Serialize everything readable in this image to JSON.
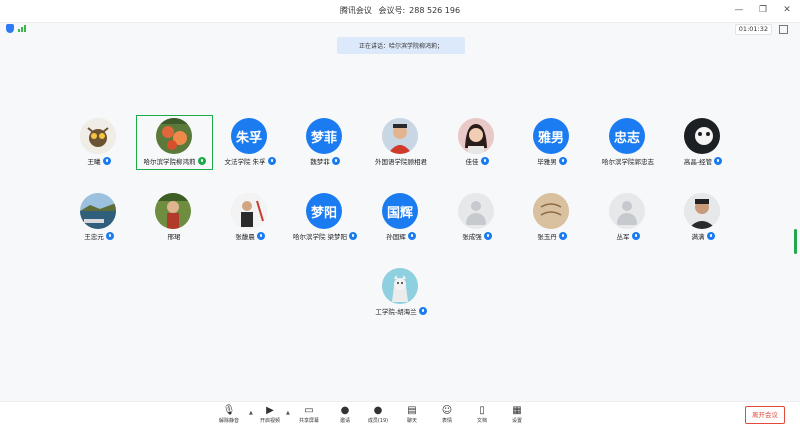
{
  "window": {
    "app_name": "腾讯会议",
    "meeting_id_label": "会议号:",
    "meeting_id": "288 526 196"
  },
  "status": {
    "timer": "01:01:32"
  },
  "speaker": {
    "text": "正在讲话：哈尔滨学院柳鸿莉；"
  },
  "participants": [
    {
      "name": "王曦",
      "avatar_type": "photo",
      "mic": "blue"
    },
    {
      "name": "哈尔滨学院柳鸿莉",
      "avatar_type": "photo",
      "mic": "green"
    },
    {
      "name": "文法学院 朱孚",
      "avatar_type": "text",
      "avatar_text": "朱孚",
      "mic": "blue"
    },
    {
      "name": "魏梦菲",
      "avatar_type": "text",
      "avatar_text": "梦菲",
      "mic": "blue"
    },
    {
      "name": "外国语学院顾相君",
      "avatar_type": "photo",
      "mic": "none"
    },
    {
      "name": "佳佳",
      "avatar_type": "photo",
      "mic": "blue"
    },
    {
      "name": "毕雅男",
      "avatar_type": "text",
      "avatar_text": "雅男",
      "mic": "blue"
    },
    {
      "name": "哈尔滨学院郭忠志",
      "avatar_type": "text",
      "avatar_text": "忠志",
      "mic": "none"
    },
    {
      "name": "高晶-经管",
      "avatar_type": "photo",
      "mic": "blue"
    },
    {
      "name": "王忠元",
      "avatar_type": "photo",
      "mic": "blue"
    },
    {
      "name": "邢珺",
      "avatar_type": "photo",
      "mic": "none"
    },
    {
      "name": "张馥晨",
      "avatar_type": "photo",
      "mic": "blue"
    },
    {
      "name": "哈尔滨学院 梁梦阳",
      "avatar_type": "text",
      "avatar_text": "梦阳",
      "mic": "blue"
    },
    {
      "name": "孙国辉",
      "avatar_type": "text",
      "avatar_text": "国辉",
      "mic": "blue"
    },
    {
      "name": "张成强",
      "avatar_type": "placeholder",
      "mic": "blue"
    },
    {
      "name": "张玉丹",
      "avatar_type": "photo",
      "mic": "blue"
    },
    {
      "name": "丛军",
      "avatar_type": "placeholder",
      "mic": "blue"
    },
    {
      "name": "满满",
      "avatar_type": "photo",
      "mic": "blue"
    },
    {
      "name": "工学院-胡海兰",
      "avatar_type": "photo",
      "mic": "blue"
    }
  ],
  "toolbar": {
    "items": [
      {
        "label": "解除静音",
        "icon": "mic-muted-icon"
      },
      {
        "label": "开启视频",
        "icon": "video-off-icon"
      },
      {
        "label": "共享屏幕",
        "icon": "screen-share-icon"
      },
      {
        "label": "邀请",
        "icon": "invite-icon"
      },
      {
        "label": "成员(19)",
        "icon": "members-icon"
      },
      {
        "label": "聊天",
        "icon": "chat-icon"
      },
      {
        "label": "表情",
        "icon": "emoji-icon"
      },
      {
        "label": "文档",
        "icon": "document-icon"
      },
      {
        "label": "设置",
        "icon": "settings-icon"
      }
    ],
    "leave_label": "离开会议"
  },
  "colors": {
    "accent": "#1a7cf0",
    "active_border": "#1ea94a",
    "leave": "#e14b3b"
  }
}
